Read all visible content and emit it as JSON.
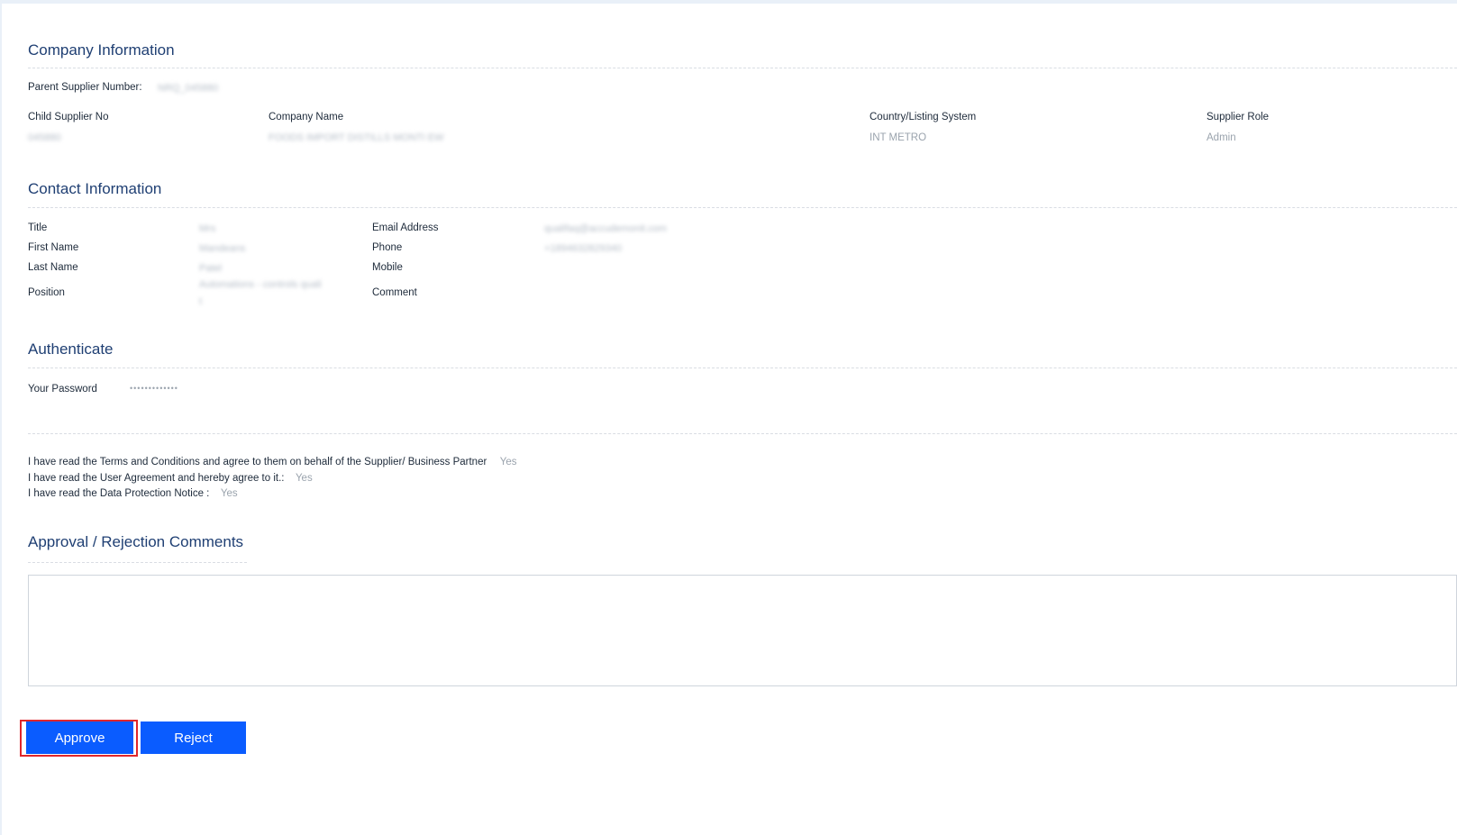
{
  "company": {
    "heading": "Company Information",
    "parent_supplier_label": "Parent Supplier Number:",
    "parent_supplier_value": "NRQ_045880",
    "child_supplier_label": "Child Supplier No",
    "child_supplier_value": "045880",
    "company_name_label": "Company Name",
    "company_name_value": "FOODS IMPORT DISTILLS MONTI EW",
    "country_label": "Country/Listing System",
    "country_value": "INT METRO",
    "role_label": "Supplier Role",
    "role_value": "Admin"
  },
  "contact": {
    "heading": "Contact Information",
    "title_label": "Title",
    "title_value": "Mrs",
    "first_name_label": "First Name",
    "first_name_value": "Mandeans",
    "last_name_label": "Last Name",
    "last_name_value": "Patel",
    "position_label": "Position",
    "position_value_line1": "Automations - controls quali",
    "position_value_line2": "t",
    "email_label": "Email Address",
    "email_value": "qualifaq@accudemonit.com",
    "phone_label": "Phone",
    "phone_value": "+1894632829340",
    "mobile_label": "Mobile",
    "comment_label": "Comment"
  },
  "authenticate": {
    "heading": "Authenticate",
    "password_label": "Your Password",
    "password_value": "•••••••••••••"
  },
  "agreements": {
    "terms_label": "I have read the Terms and Conditions and agree to them on behalf of the Supplier/ Business Partner",
    "terms_value": "Yes",
    "user_agreement_label": "I have read the User Agreement and hereby agree to it.:",
    "user_agreement_value": "Yes",
    "data_protection_label": "I have read the Data Protection Notice :",
    "data_protection_value": "Yes"
  },
  "approval": {
    "heading": "Approval / Rejection Comments",
    "comment_value": "",
    "approve_label": "Approve",
    "reject_label": "Reject"
  },
  "colors": {
    "heading": "#1f3f73",
    "button": "#0a5cff",
    "highlight": "#e0262c"
  }
}
